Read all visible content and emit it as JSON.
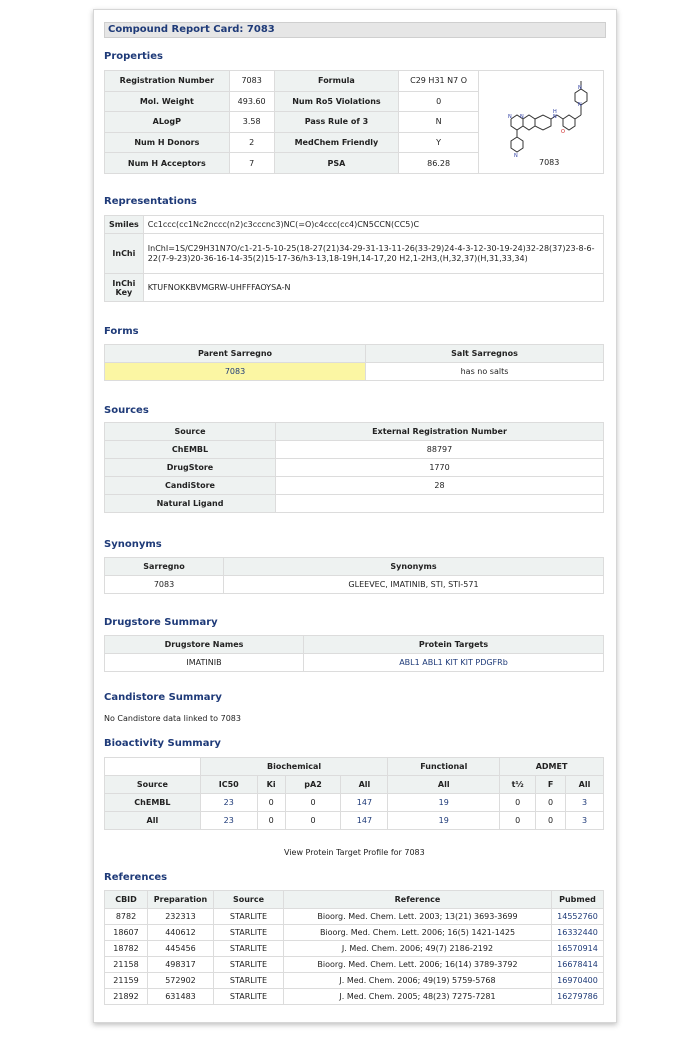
{
  "title": "Compound Report Card: 7083",
  "properties": {
    "heading": "Properties",
    "rows": [
      {
        "l1": "Registration Number",
        "v1": "7083",
        "l2": "Formula",
        "v2": "C29 H31 N7 O"
      },
      {
        "l1": "Mol. Weight",
        "v1": "493.60",
        "l2": "Num Ro5 Violations",
        "v2": "0"
      },
      {
        "l1": "ALogP",
        "v1": "3.58",
        "l2": "Pass Rule of 3",
        "v2": "N"
      },
      {
        "l1": "Num H Donors",
        "v1": "2",
        "l2": "MedChem Friendly",
        "v2": "Y"
      },
      {
        "l1": "Num H Acceptors",
        "v1": "7",
        "l2": "PSA",
        "v2": "86.28"
      }
    ],
    "structure_label": "7083"
  },
  "representations": {
    "heading": "Representations",
    "smiles_label": "Smiles",
    "smiles": "Cc1ccc(cc1Nc2nccc(n2)c3cccnc3)NC(=O)c4ccc(cc4)CN5CCN(CC5)C",
    "inchi_label": "InChi",
    "inchi": "InChI=1S/C29H31N7O/c1-21-5-10-25(18-27(21)34-29-31-13-11-26(33-29)24-4-3-12-30-19-24)32-28(37)23-8-6-22(7-9-23)20-36-16-14-35(2)15-17-36/h3-13,18-19H,14-17,20 H2,1-2H3,(H,32,37)(H,31,33,34)",
    "inchikey_label_1": "InChi",
    "inchikey_label_2": "Key",
    "inchikey": "KTUFNOKKBVMGRW-UHFFFAOYSA-N"
  },
  "forms": {
    "heading": "Forms",
    "col1": "Parent Sarregno",
    "col2": "Salt Sarregnos",
    "parent": "7083",
    "salts": "has no salts"
  },
  "sources": {
    "heading": "Sources",
    "col1": "Source",
    "col2": "External Registration Number",
    "rows": [
      {
        "source": "ChEMBL",
        "ext": "88797"
      },
      {
        "source": "DrugStore",
        "ext": "1770"
      },
      {
        "source": "CandiStore",
        "ext": "28"
      },
      {
        "source": "Natural Ligand",
        "ext": ""
      }
    ]
  },
  "synonyms": {
    "heading": "Synonyms",
    "col1": "Sarregno",
    "col2": "Synonyms",
    "sarregno": "7083",
    "values": "GLEEVEC, IMATINIB, STI, STI-571"
  },
  "drugstore": {
    "heading": "Drugstore Summary",
    "col1": "Drugstore Names",
    "col2": "Protein Targets",
    "name": "IMATINIB",
    "targets": "ABL1 ABL1 KIT KIT PDGFRb"
  },
  "candistore": {
    "heading": "Candistore Summary",
    "text": "No Candistore data linked to 7083"
  },
  "bioactivity": {
    "heading": "Bioactivity Summary",
    "group_biochemical": "Biochemical",
    "group_functional": "Functional",
    "group_admet": "ADMET",
    "cols": [
      "Source",
      "IC50",
      "Ki",
      "pA2",
      "All",
      "All",
      "t½",
      "F",
      "All"
    ],
    "rows": [
      [
        "ChEMBL",
        "23",
        "0",
        "0",
        "147",
        "19",
        "0",
        "0",
        "3"
      ],
      [
        "All",
        "23",
        "0",
        "0",
        "147",
        "19",
        "0",
        "0",
        "3"
      ]
    ],
    "profile_link": "View Protein Target Profile for 7083"
  },
  "references": {
    "heading": "References",
    "cols": [
      "CBID",
      "Preparation",
      "Source",
      "Reference",
      "Pubmed"
    ],
    "rows": [
      [
        "8782",
        "232313",
        "STARLITE",
        "Bioorg. Med. Chem. Lett. 2003; 13(21) 3693-3699",
        "14552760"
      ],
      [
        "18607",
        "440612",
        "STARLITE",
        "Bioorg. Med. Chem. Lett. 2006; 16(5) 1421-1425",
        "16332440"
      ],
      [
        "18782",
        "445456",
        "STARLITE",
        "J. Med. Chem. 2006; 49(7) 2186-2192",
        "16570914"
      ],
      [
        "21158",
        "498317",
        "STARLITE",
        "Bioorg. Med. Chem. Lett. 2006; 16(14) 3789-3792",
        "16678414"
      ],
      [
        "21159",
        "572902",
        "STARLITE",
        "J. Med. Chem. 2006; 49(19) 5759-5768",
        "16970400"
      ],
      [
        "21892",
        "631483",
        "STARLITE",
        "J. Med. Chem. 2005; 48(23) 7275-7281",
        "16279786"
      ]
    ]
  }
}
